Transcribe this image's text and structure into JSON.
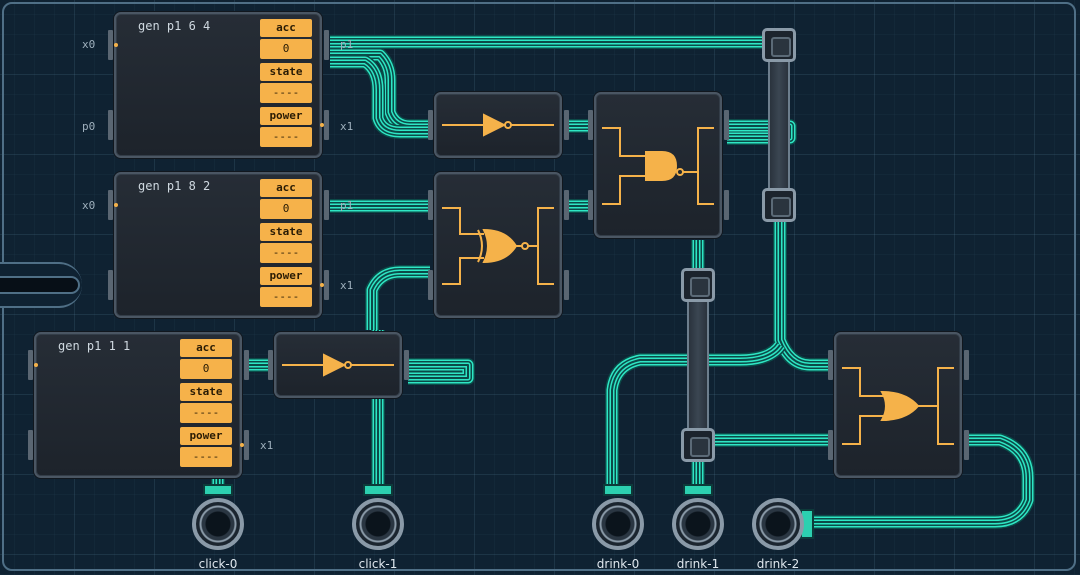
{
  "generators": [
    {
      "title": "gen p1 6 4",
      "port_x0": "x0",
      "port_p0": "p0",
      "port_p1": "p1",
      "port_x1": "x1",
      "regs": [
        {
          "label": "acc",
          "value": "0"
        },
        {
          "label": "state",
          "value": "----"
        },
        {
          "label": "power",
          "value": "----"
        }
      ]
    },
    {
      "title": "gen p1 8 2",
      "port_x0": "x0",
      "port_p1": "p1",
      "port_x1": "x1",
      "regs": [
        {
          "label": "acc",
          "value": "0"
        },
        {
          "label": "state",
          "value": "----"
        },
        {
          "label": "power",
          "value": "----"
        }
      ]
    },
    {
      "title": "gen p1 1 1",
      "port_x1": "x1",
      "regs": [
        {
          "label": "acc",
          "value": "0"
        },
        {
          "label": "state",
          "value": "----"
        },
        {
          "label": "power",
          "value": "----"
        }
      ]
    }
  ],
  "gates": [
    {
      "type": "not-gate-icon"
    },
    {
      "type": "xor-gate-icon"
    },
    {
      "type": "and-gate-icon"
    },
    {
      "type": "not-gate-icon"
    },
    {
      "type": "or-gate-icon"
    }
  ],
  "pins": [
    {
      "label": "click-0"
    },
    {
      "label": "click-1"
    },
    {
      "label": "drink-0"
    },
    {
      "label": "drink-1"
    },
    {
      "label": "drink-2"
    }
  ],
  "colors": {
    "wire": "#2ee6c4",
    "wire_dark": "#0b4a48",
    "gate": "#f5b24a",
    "register": "#f6b24a"
  }
}
